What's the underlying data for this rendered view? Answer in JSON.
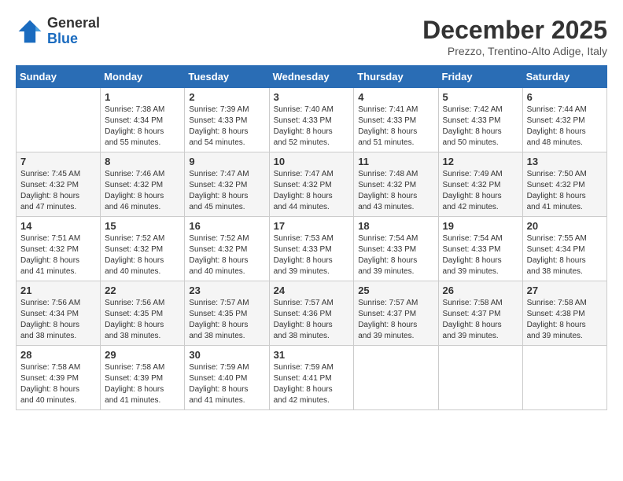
{
  "logo": {
    "general": "General",
    "blue": "Blue"
  },
  "title": "December 2025",
  "subtitle": "Prezzo, Trentino-Alto Adige, Italy",
  "days_of_week": [
    "Sunday",
    "Monday",
    "Tuesday",
    "Wednesday",
    "Thursday",
    "Friday",
    "Saturday"
  ],
  "weeks": [
    [
      {
        "day": "",
        "info": ""
      },
      {
        "day": "1",
        "info": "Sunrise: 7:38 AM\nSunset: 4:34 PM\nDaylight: 8 hours\nand 55 minutes."
      },
      {
        "day": "2",
        "info": "Sunrise: 7:39 AM\nSunset: 4:33 PM\nDaylight: 8 hours\nand 54 minutes."
      },
      {
        "day": "3",
        "info": "Sunrise: 7:40 AM\nSunset: 4:33 PM\nDaylight: 8 hours\nand 52 minutes."
      },
      {
        "day": "4",
        "info": "Sunrise: 7:41 AM\nSunset: 4:33 PM\nDaylight: 8 hours\nand 51 minutes."
      },
      {
        "day": "5",
        "info": "Sunrise: 7:42 AM\nSunset: 4:33 PM\nDaylight: 8 hours\nand 50 minutes."
      },
      {
        "day": "6",
        "info": "Sunrise: 7:44 AM\nSunset: 4:32 PM\nDaylight: 8 hours\nand 48 minutes."
      }
    ],
    [
      {
        "day": "7",
        "info": "Sunrise: 7:45 AM\nSunset: 4:32 PM\nDaylight: 8 hours\nand 47 minutes."
      },
      {
        "day": "8",
        "info": "Sunrise: 7:46 AM\nSunset: 4:32 PM\nDaylight: 8 hours\nand 46 minutes."
      },
      {
        "day": "9",
        "info": "Sunrise: 7:47 AM\nSunset: 4:32 PM\nDaylight: 8 hours\nand 45 minutes."
      },
      {
        "day": "10",
        "info": "Sunrise: 7:47 AM\nSunset: 4:32 PM\nDaylight: 8 hours\nand 44 minutes."
      },
      {
        "day": "11",
        "info": "Sunrise: 7:48 AM\nSunset: 4:32 PM\nDaylight: 8 hours\nand 43 minutes."
      },
      {
        "day": "12",
        "info": "Sunrise: 7:49 AM\nSunset: 4:32 PM\nDaylight: 8 hours\nand 42 minutes."
      },
      {
        "day": "13",
        "info": "Sunrise: 7:50 AM\nSunset: 4:32 PM\nDaylight: 8 hours\nand 41 minutes."
      }
    ],
    [
      {
        "day": "14",
        "info": "Sunrise: 7:51 AM\nSunset: 4:32 PM\nDaylight: 8 hours\nand 41 minutes."
      },
      {
        "day": "15",
        "info": "Sunrise: 7:52 AM\nSunset: 4:32 PM\nDaylight: 8 hours\nand 40 minutes."
      },
      {
        "day": "16",
        "info": "Sunrise: 7:52 AM\nSunset: 4:32 PM\nDaylight: 8 hours\nand 40 minutes."
      },
      {
        "day": "17",
        "info": "Sunrise: 7:53 AM\nSunset: 4:33 PM\nDaylight: 8 hours\nand 39 minutes."
      },
      {
        "day": "18",
        "info": "Sunrise: 7:54 AM\nSunset: 4:33 PM\nDaylight: 8 hours\nand 39 minutes."
      },
      {
        "day": "19",
        "info": "Sunrise: 7:54 AM\nSunset: 4:33 PM\nDaylight: 8 hours\nand 39 minutes."
      },
      {
        "day": "20",
        "info": "Sunrise: 7:55 AM\nSunset: 4:34 PM\nDaylight: 8 hours\nand 38 minutes."
      }
    ],
    [
      {
        "day": "21",
        "info": "Sunrise: 7:56 AM\nSunset: 4:34 PM\nDaylight: 8 hours\nand 38 minutes."
      },
      {
        "day": "22",
        "info": "Sunrise: 7:56 AM\nSunset: 4:35 PM\nDaylight: 8 hours\nand 38 minutes."
      },
      {
        "day": "23",
        "info": "Sunrise: 7:57 AM\nSunset: 4:35 PM\nDaylight: 8 hours\nand 38 minutes."
      },
      {
        "day": "24",
        "info": "Sunrise: 7:57 AM\nSunset: 4:36 PM\nDaylight: 8 hours\nand 38 minutes."
      },
      {
        "day": "25",
        "info": "Sunrise: 7:57 AM\nSunset: 4:37 PM\nDaylight: 8 hours\nand 39 minutes."
      },
      {
        "day": "26",
        "info": "Sunrise: 7:58 AM\nSunset: 4:37 PM\nDaylight: 8 hours\nand 39 minutes."
      },
      {
        "day": "27",
        "info": "Sunrise: 7:58 AM\nSunset: 4:38 PM\nDaylight: 8 hours\nand 39 minutes."
      }
    ],
    [
      {
        "day": "28",
        "info": "Sunrise: 7:58 AM\nSunset: 4:39 PM\nDaylight: 8 hours\nand 40 minutes."
      },
      {
        "day": "29",
        "info": "Sunrise: 7:58 AM\nSunset: 4:39 PM\nDaylight: 8 hours\nand 41 minutes."
      },
      {
        "day": "30",
        "info": "Sunrise: 7:59 AM\nSunset: 4:40 PM\nDaylight: 8 hours\nand 41 minutes."
      },
      {
        "day": "31",
        "info": "Sunrise: 7:59 AM\nSunset: 4:41 PM\nDaylight: 8 hours\nand 42 minutes."
      },
      {
        "day": "",
        "info": ""
      },
      {
        "day": "",
        "info": ""
      },
      {
        "day": "",
        "info": ""
      }
    ]
  ]
}
